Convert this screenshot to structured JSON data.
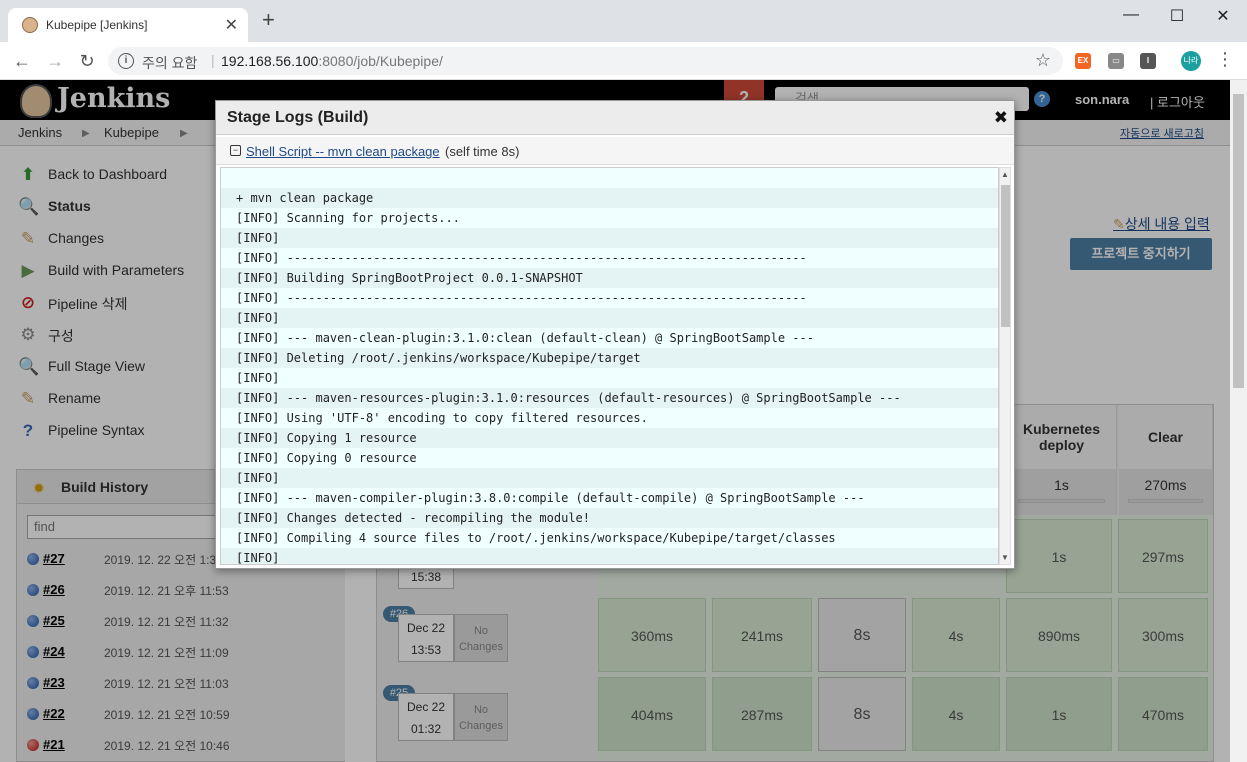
{
  "browser": {
    "tab_title": "Kubepipe [Jenkins]",
    "new_tab": "+",
    "security_label": "주의 요함",
    "url_host": "192.168.56.100",
    "url_rest": ":8080/job/Kubepipe/",
    "profile_initials": "나라",
    "extensions": [
      {
        "name": "ex-extension-icon",
        "text": "EX",
        "color": "#f26522"
      },
      {
        "name": "reader-extension-icon",
        "text": "▭",
        "color": "#888888"
      },
      {
        "name": "info-extension-icon",
        "text": "I",
        "color": "#555555"
      }
    ]
  },
  "jenkins": {
    "brand": "Jenkins",
    "alert_count": "2",
    "search_placeholder": "검색",
    "username": "son.nara",
    "logout": "| 로그아웃",
    "breadcrumb": [
      "Jenkins",
      "Kubepipe"
    ],
    "auto_refresh": "자동으로 새로고침"
  },
  "sidebar": {
    "items": [
      {
        "label": "Back to Dashboard",
        "icon": "up-arrow-icon",
        "color": "#3a9a3a"
      },
      {
        "label": "Status",
        "icon": "magnifier-icon",
        "color": "#8aa0b8"
      },
      {
        "label": "Changes",
        "icon": "notepad-icon",
        "color": "#c8a060"
      },
      {
        "label": "Build with Parameters",
        "icon": "clock-play-icon",
        "color": "#6a9a5a"
      },
      {
        "label": "Pipeline 삭제",
        "icon": "no-entry-icon",
        "color": "#d02020"
      },
      {
        "label": "구성",
        "icon": "gear-icon",
        "color": "#888888"
      },
      {
        "label": "Full Stage View",
        "icon": "magnifier-icon",
        "color": "#8aa0b8"
      },
      {
        "label": "Rename",
        "icon": "notepad-icon",
        "color": "#c8a060"
      },
      {
        "label": "Pipeline Syntax",
        "icon": "help-icon",
        "color": "#3a6ab8"
      }
    ]
  },
  "build_history": {
    "title": "Build History",
    "find_placeholder": "find",
    "builds": [
      {
        "num": "#27",
        "date": "2019. 12. 22 오전 1:3",
        "status": "blue"
      },
      {
        "num": "#26",
        "date": "2019. 12. 21 오후 11:53",
        "status": "blue"
      },
      {
        "num": "#25",
        "date": "2019. 12. 21 오전 11:32",
        "status": "blue"
      },
      {
        "num": "#24",
        "date": "2019. 12. 21 오전 11:09",
        "status": "blue"
      },
      {
        "num": "#23",
        "date": "2019. 12. 21 오전 11:03",
        "status": "blue"
      },
      {
        "num": "#22",
        "date": "2019. 12. 21 오전 10:59",
        "status": "blue"
      },
      {
        "num": "#21",
        "date": "2019. 12. 21 오전 10:46",
        "status": "red"
      }
    ]
  },
  "stage_view": {
    "detail_link": "상세 내용 입력",
    "stop_button": "프로젝트 중지하기",
    "headers": [
      "Kubernetes deploy",
      "Clear"
    ],
    "averages": [
      "1s",
      "270ms"
    ],
    "rows": [
      {
        "num": "",
        "date": "",
        "time": "15:38",
        "no_changes": "",
        "cells": [
          "",
          "",
          "",
          "",
          "1s",
          "297ms"
        ]
      },
      {
        "num": "#26",
        "date": "Dec 22",
        "time": "13:53",
        "no_changes": "No Changes",
        "cells": [
          "360ms",
          "241ms",
          "8s",
          "4s",
          "890ms",
          "300ms"
        ]
      },
      {
        "num": "#25",
        "date": "Dec 22",
        "time": "01:32",
        "no_changes": "No Changes",
        "cells": [
          "404ms",
          "287ms",
          "8s",
          "4s",
          "1s",
          "470ms"
        ]
      }
    ]
  },
  "modal": {
    "title": "Stage Logs (Build)",
    "close": "✖",
    "step_link": "Shell Script -- mvn clean package ",
    "step_time": "(self time 8s)",
    "log_lines": [
      "",
      "+ mvn clean package",
      "[INFO] Scanning for projects...",
      "[INFO]",
      "[INFO] ------------------------------------------------------------------------",
      "[INFO] Building SpringBootProject 0.0.1-SNAPSHOT",
      "[INFO] ------------------------------------------------------------------------",
      "[INFO]",
      "[INFO] --- maven-clean-plugin:3.1.0:clean (default-clean) @ SpringBootSample ---",
      "[INFO] Deleting /root/.jenkins/workspace/Kubepipe/target",
      "[INFO]",
      "[INFO] --- maven-resources-plugin:3.1.0:resources (default-resources) @ SpringBootSample ---",
      "[INFO] Using 'UTF-8' encoding to copy filtered resources.",
      "[INFO] Copying 1 resource",
      "[INFO] Copying 0 resource",
      "[INFO]",
      "[INFO] --- maven-compiler-plugin:3.8.0:compile (default-compile) @ SpringBootSample ---",
      "[INFO] Changes detected - recompiling the module!",
      "[INFO] Compiling 4 source files to /root/.jenkins/workspace/Kubepipe/target/classes",
      "[INFO]"
    ]
  }
}
